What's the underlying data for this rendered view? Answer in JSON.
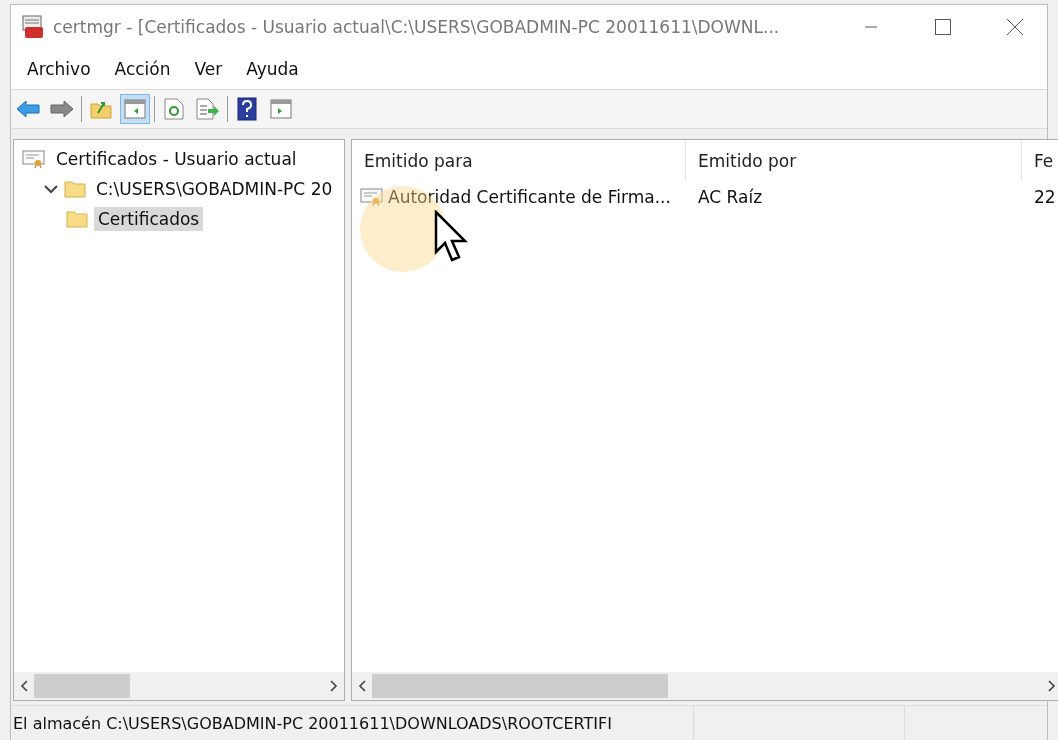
{
  "window": {
    "title": "certmgr - [Certificados - Usuario actual\\C:\\USERS\\GOBADMIN-PC 20011611\\DOWNL..."
  },
  "menu": [
    "Archivo",
    "Acción",
    "Ver",
    "Ayuda"
  ],
  "toolbar": [
    [
      {
        "kind": "back",
        "pressed": false
      },
      {
        "kind": "forward",
        "pressed": false
      }
    ],
    [
      {
        "kind": "up",
        "pressed": false
      },
      {
        "kind": "tree",
        "pressed": true
      }
    ],
    [
      {
        "kind": "refresh",
        "pressed": false
      },
      {
        "kind": "export",
        "pressed": false
      }
    ],
    [
      {
        "kind": "help",
        "pressed": false
      },
      {
        "kind": "action",
        "pressed": false
      }
    ]
  ],
  "tree": {
    "label": "Certificados - Usuario actual",
    "children": [
      {
        "label": "C:\\USERS\\GOBADMIN-PC 20",
        "expanded": true,
        "selected": false,
        "children": [
          {
            "label": "Certificados",
            "selected": true
          }
        ]
      }
    ]
  },
  "table": {
    "columns": [
      "Emitido para",
      "Emitido por",
      "Fe"
    ],
    "rows": [
      [
        "Autoridad Certificante de Firma...",
        "AC Raíz",
        "22"
      ]
    ]
  },
  "status_bar": "El almacén C:\\USERS\\GOBADMIN-PC 20011611\\DOWNLOADS\\ROOTCERTIFI"
}
